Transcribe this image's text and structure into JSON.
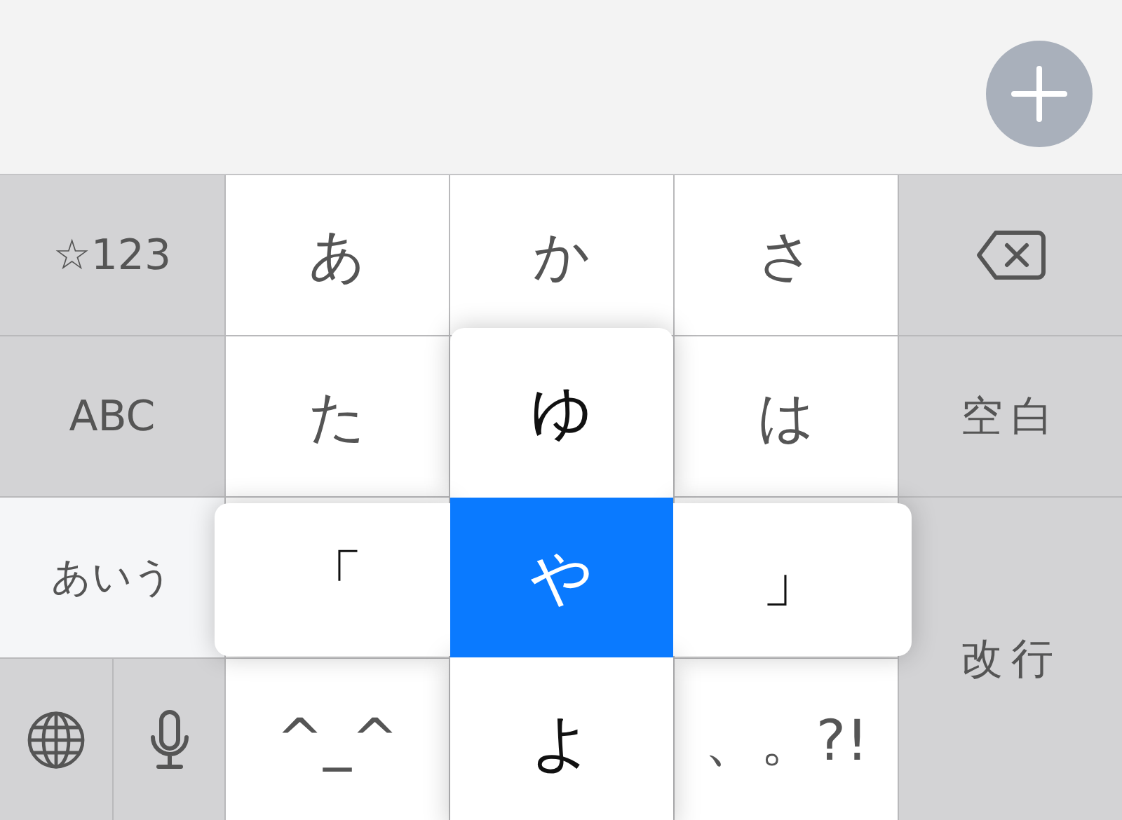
{
  "top_bar": {
    "add_button": {
      "kind": "plus"
    }
  },
  "keyboard": {
    "keys": [
      {
        "kind": "mode",
        "label": "☆123"
      },
      {
        "kind": "kana",
        "label": "あ"
      },
      {
        "kind": "kana",
        "label": "か"
      },
      {
        "kind": "kana",
        "label": "さ"
      },
      {
        "kind": "backspace"
      },
      {
        "kind": "mode",
        "label": "ABC"
      },
      {
        "kind": "kana",
        "label": "た"
      },
      {
        "kind": "blank"
      },
      {
        "kind": "kana",
        "label": "は"
      },
      {
        "kind": "space",
        "label": "空白"
      },
      {
        "kind": "current_mode",
        "label": "あいう"
      },
      {
        "kind": "blank"
      },
      {
        "kind": "flick",
        "options": [
          {
            "kind": "up",
            "label": "ゆ",
            "selected": false
          },
          {
            "kind": "left",
            "label": "「",
            "selected": false
          },
          {
            "kind": "center",
            "label": "や",
            "selected": true
          },
          {
            "kind": "right",
            "label": "」",
            "selected": false
          },
          {
            "kind": "down",
            "label": "よ",
            "selected": false
          }
        ]
      },
      {
        "kind": "blank"
      },
      {
        "kind": "return",
        "label": "改行"
      },
      {
        "kind": "globe"
      },
      {
        "kind": "mic"
      },
      {
        "kind": "kana",
        "label": "^_^"
      },
      {
        "kind": "blank"
      },
      {
        "kind": "kana",
        "label": "、。?!"
      }
    ]
  }
}
